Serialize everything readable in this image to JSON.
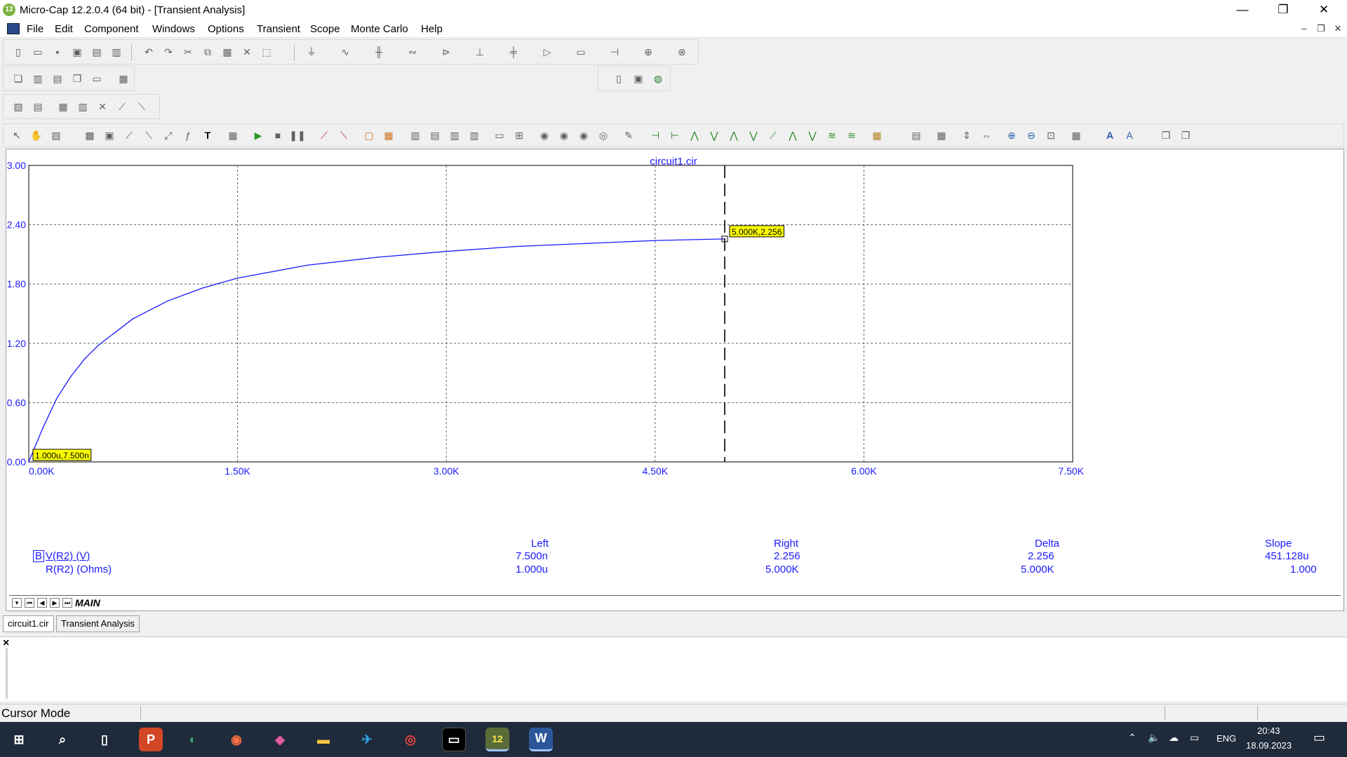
{
  "window": {
    "title": "Micro-Cap 12.2.0.4 (64 bit) - [Transient Analysis]",
    "app_icon_text": "12",
    "minimize": "—",
    "restore": "❐",
    "close": "✕"
  },
  "menu": {
    "items": [
      "File",
      "Edit",
      "Component",
      "Windows",
      "Options",
      "Transient",
      "Scope",
      "Monte Carlo",
      "Help"
    ]
  },
  "plot": {
    "title": "circuit1.cir",
    "y_ticks": [
      "3.00",
      "2.40",
      "1.80",
      "1.20",
      "0.60",
      "0.00"
    ],
    "x_ticks": [
      "0.00K",
      "1.50K",
      "3.00K",
      "4.50K",
      "6.00K",
      "7.50K"
    ],
    "cursor_right_label": "5.000K,2.256",
    "cursor_left_label": "1.000u,7.500n",
    "curve_color": "#1a1aff",
    "label_bg": "#ffff00"
  },
  "chart_data": {
    "type": "line",
    "title": "circuit1.cir",
    "xlabel": "R(R2) (Ohms)",
    "ylabel": "V(R2) (V)",
    "xlim": [
      0,
      7500
    ],
    "ylim": [
      0,
      3
    ],
    "grid": true,
    "series": [
      {
        "name": "V(R2) (V)",
        "x": [
          1e-06,
          100,
          200,
          300,
          400,
          500,
          750,
          1000,
          1250,
          1500,
          2000,
          2500,
          3000,
          3500,
          4000,
          4500,
          5000
        ],
        "y": [
          7.5e-09,
          0.34,
          0.64,
          0.86,
          1.04,
          1.18,
          1.45,
          1.63,
          1.76,
          1.86,
          1.99,
          2.07,
          2.13,
          2.18,
          2.21,
          2.24,
          2.256
        ]
      }
    ],
    "cursors": {
      "left": {
        "x": "1.000u",
        "y": "7.500n"
      },
      "right": {
        "x": "5.000K",
        "y": "2.256"
      }
    }
  },
  "readout": {
    "headers": {
      "left": "Left",
      "right": "Right",
      "delta": "Delta",
      "slope": "Slope"
    },
    "rows": [
      {
        "prefix": "B",
        "name": "V(R2) (V)",
        "left": "7.500n",
        "right": "2.256",
        "delta": "2.256",
        "slope": "451.128u"
      },
      {
        "prefix": "",
        "name": "R(R2) (Ohms)",
        "left": "1.000u",
        "right": "5.000K",
        "delta": "5.000K",
        "slope": "1.000"
      }
    ]
  },
  "page_tabs": {
    "active": "MAIN"
  },
  "doc_tabs": [
    "circuit1.cir",
    "Transient Analysis"
  ],
  "output_close": "×",
  "status": {
    "text": "Cursor Mode"
  },
  "taskbar": {
    "lang": "ENG",
    "time": "20:43",
    "date": "18.09.2023",
    "apps": [
      "windows-start",
      "search",
      "task-view",
      "powerpoint",
      "edge-dev",
      "media",
      "droplet",
      "file-explorer",
      "telegram",
      "chrome",
      "terminal",
      "microcap",
      "word"
    ]
  }
}
